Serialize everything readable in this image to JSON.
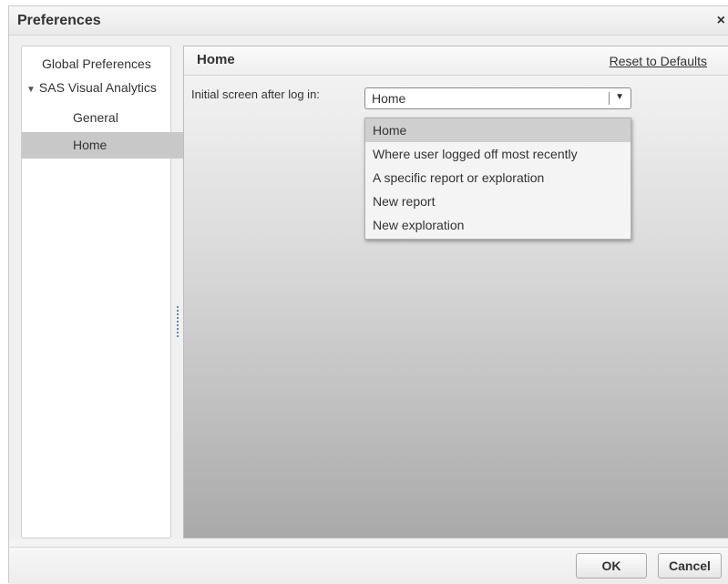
{
  "dialog": {
    "title": "Preferences",
    "close": "×"
  },
  "nav": {
    "global": "Global Preferences",
    "sas": "SAS Visual Analytics",
    "sas_icon": "triangle-down-icon",
    "general": "General",
    "home": "Home"
  },
  "content": {
    "title": "Home",
    "reset": "Reset to Defaults",
    "field_label": "Initial screen after log in:",
    "selected": "Home",
    "options": [
      "Home",
      "Where user logged off most recently",
      "A specific report or exploration",
      "New report",
      "New exploration"
    ]
  },
  "footer": {
    "ok": "OK",
    "cancel": "Cancel"
  }
}
